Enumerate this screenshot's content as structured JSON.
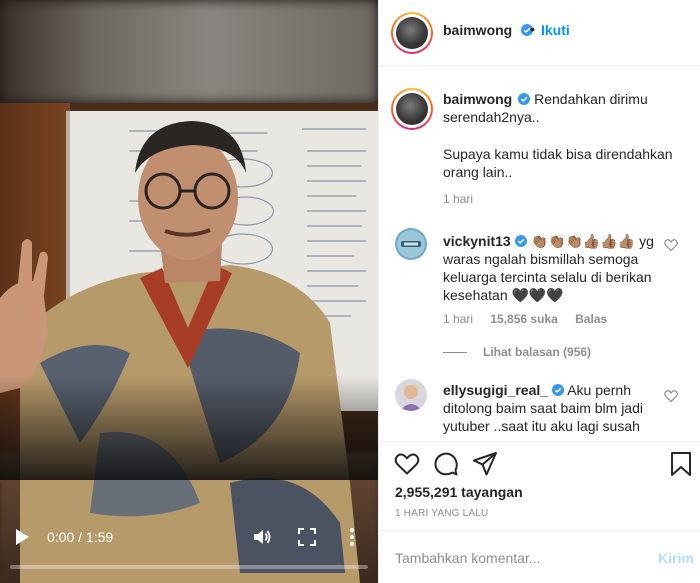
{
  "post": {
    "username": "baimwong",
    "follow_label": "Ikuti",
    "separator": "•",
    "caption_line1": "Rendahkan dirimu serendah2nya..",
    "caption_line2": "Supaya kamu tidak bisa direndahkan orang lain..",
    "caption_time": "1 hari"
  },
  "comments": [
    {
      "username": "vickynit13",
      "text": "👏🏽👏🏽👏🏽👍🏽👍🏽👍🏽 yg waras ngalah bismillah semoga keluarga tercinta selalu di berikan kesehatan 🖤🖤🖤",
      "time": "1 hari",
      "likes": "15,856 suka",
      "reply_label": "Balas",
      "view_replies": "Lihat balasan (956)"
    },
    {
      "username": "ellysugigi_real_",
      "text": "Aku pernh ditolong baim saat baim blm jadi yutuber ..saat itu aku lagi susah"
    }
  ],
  "stats": {
    "views": "2,955,291 tayangan",
    "posted_ago": "1 HARI YANG LALU"
  },
  "comment_box": {
    "placeholder": "Tambahkan komentar...",
    "post_label": "Kirim"
  },
  "video": {
    "time": "0:00 / 1:59",
    "progress": 0.0
  },
  "colors": {
    "accent": "#0095f6",
    "post_disabled": "#b2dffc",
    "muted": "#8e8e8e"
  }
}
